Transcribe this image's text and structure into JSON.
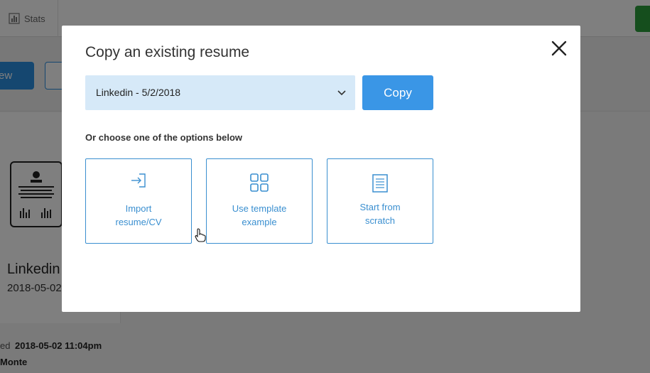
{
  "app": {
    "stats_tab": "Stats",
    "blue_button": "ew",
    "card": {
      "title": "Linkedin",
      "date": "2018-05-02",
      "meta_label": "ed",
      "meta_value": "2018-05-02 11:04pm",
      "owner": "Monte"
    }
  },
  "modal": {
    "title": "Copy an existing resume",
    "select": {
      "value": "Linkedin - 5/2/2018",
      "icon": "chevron-down-icon"
    },
    "copy_label": "Copy",
    "or_label": "Or choose one of the options below",
    "options": [
      {
        "icon": "import-icon",
        "line1": "Import",
        "line2": "resume/CV"
      },
      {
        "icon": "grid-icon",
        "line1": "Use template",
        "line2": "example"
      },
      {
        "icon": "document-icon",
        "line1": "Start from",
        "line2": "scratch"
      }
    ],
    "close_icon": "close-icon"
  },
  "colors": {
    "accent": "#3a96e6",
    "select_bg": "#d6e9f8",
    "option_border": "#3a8fd0",
    "overlay": "rgba(0,0,0,0.5)"
  }
}
